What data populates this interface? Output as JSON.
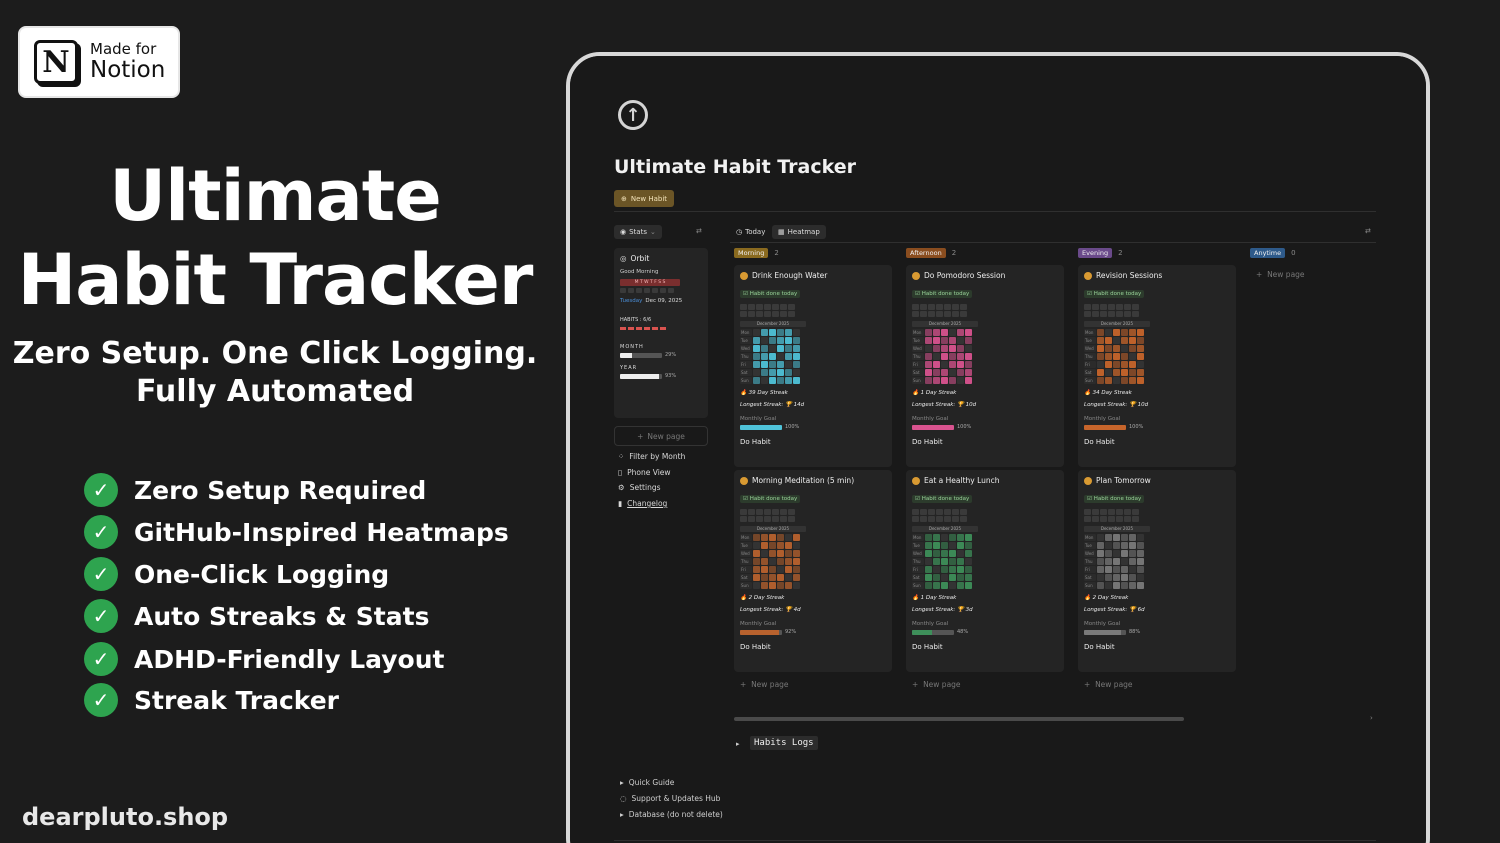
{
  "badge": {
    "line1": "Made for",
    "line2": "Notion",
    "logo_letter": "N"
  },
  "hero": {
    "title_line1": "Ultimate",
    "title_line2": "Habit Tracker",
    "subtitle_line1": "Zero Setup. One Click Logging.",
    "subtitle_line2": "Fully Automated"
  },
  "features": [
    "Zero Setup Required",
    "GitHub-Inspired Heatmaps",
    "One-Click Logging",
    "Auto Streaks & Stats",
    "ADHD-Friendly Layout",
    "Streak Tracker"
  ],
  "site": "dearpluto.shop",
  "notion": {
    "page_title": "Ultimate Habit Tracker",
    "new_habit": "New Habit",
    "stats_tab": "Stats",
    "view_today": "Today",
    "view_heatmap": "Heatmap",
    "orbit": {
      "title": "Orbit",
      "greeting": "Good Morning",
      "weekdays": "M T W T F S S",
      "day": "Tuesday",
      "date": "Dec 09, 2025",
      "habits_label": "HABITS : 6/6",
      "month_label": "MONTH",
      "month_pct": "29%",
      "month_value": 0.29,
      "year_label": "YEAR",
      "year_pct": "93%",
      "year_value": 0.93
    },
    "sidebar_new_page": "New page",
    "sidebar_links": [
      "Filter by Month",
      "Phone View",
      "Settings",
      "Changelog"
    ],
    "groups": [
      {
        "name": "Morning",
        "count": "2",
        "color": "#8a6a1f"
      },
      {
        "name": "Afternoon",
        "count": "2",
        "color": "#8a4d1f"
      },
      {
        "name": "Evening",
        "count": "2",
        "color": "#6a4a8a"
      },
      {
        "name": "Anytime",
        "count": "0",
        "color": "#2e5a8a"
      }
    ],
    "cards": [
      {
        "title": "Drink Enough Water",
        "done": "Habit done today",
        "month": "December 2025",
        "streak": "39 Day Streak",
        "longest": "Longest Streak: 🏆 14d",
        "goal_label": "Monthly Goal",
        "goal_pct": "100%",
        "goal_value": 1.0,
        "do": "Do Habit",
        "accent": "#4fc3d9"
      },
      {
        "title": "Do Pomodoro Session",
        "done": "Habit done today",
        "month": "December 2025",
        "streak": "1 Day Streak",
        "longest": "Longest Streak: 🏆 10d",
        "goal_label": "Monthly Goal",
        "goal_pct": "100%",
        "goal_value": 1.0,
        "do": "Do Habit",
        "accent": "#d9538f"
      },
      {
        "title": "Revision Sessions",
        "done": "Habit done today",
        "month": "December 2025",
        "streak": "34 Day Streak",
        "longest": "Longest Streak: 🏆 10d",
        "goal_label": "Monthly Goal",
        "goal_pct": "100%",
        "goal_value": 1.0,
        "do": "Do Habit",
        "accent": "#c7652b"
      },
      {
        "title": "Morning Meditation (5 min)",
        "done": "Habit done today",
        "month": "December 2025",
        "streak": "2 Day Streak",
        "longest": "Longest Streak: 🏆 4d",
        "goal_label": "Monthly Goal",
        "goal_pct": "92%",
        "goal_value": 0.92,
        "do": "Do Habit",
        "accent": "#b8622e"
      },
      {
        "title": "Eat a Healthy Lunch",
        "done": "Habit done today",
        "month": "December 2025",
        "streak": "1 Day Streak",
        "longest": "Longest Streak: 🏆 3d",
        "goal_label": "Monthly Goal",
        "goal_pct": "48%",
        "goal_value": 0.48,
        "do": "Do Habit",
        "accent": "#3e8f5a"
      },
      {
        "title": "Plan Tomorrow",
        "done": "Habit done today",
        "month": "December 2025",
        "streak": "2 Day Streak",
        "longest": "Longest Streak: 🏆 6d",
        "goal_label": "Monthly Goal",
        "goal_pct": "88%",
        "goal_value": 0.88,
        "do": "Do Habit",
        "accent": "#7a7a7a"
      }
    ],
    "day_labels": [
      "Mon",
      "Tue",
      "Wed",
      "Thu",
      "Fri",
      "Sat",
      "Sun"
    ],
    "column_new_page": "New page",
    "habits_logs": "Habits Logs",
    "bottom_links": [
      "Quick Guide",
      "Support & Updates Hub",
      "Database (do not delete)"
    ]
  }
}
